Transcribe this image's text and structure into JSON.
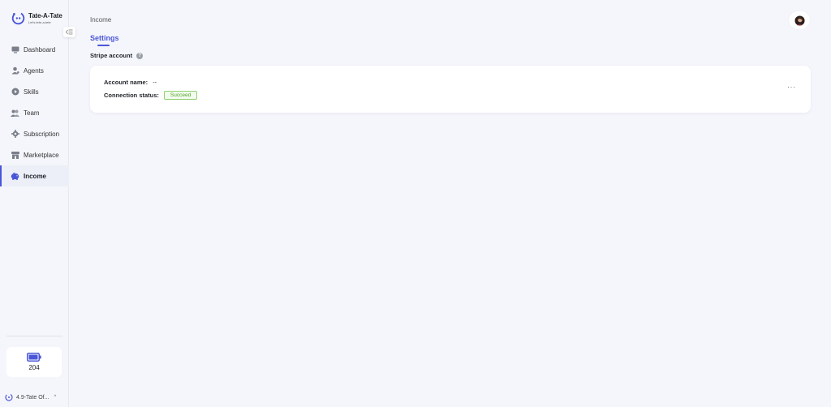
{
  "brand": {
    "name": "Tate-A-Tate",
    "tagline": "Let's tete-a-tete"
  },
  "sidebar": {
    "items": [
      {
        "label": "Dashboard",
        "icon": "dashboard-icon",
        "active": false
      },
      {
        "label": "Agents",
        "icon": "agents-icon",
        "active": false
      },
      {
        "label": "Skills",
        "icon": "skills-icon",
        "active": false
      },
      {
        "label": "Team",
        "icon": "team-icon",
        "active": false
      },
      {
        "label": "Subscription",
        "icon": "subscription-icon",
        "active": false
      },
      {
        "label": "Marketplace",
        "icon": "marketplace-icon",
        "active": false
      },
      {
        "label": "Income",
        "icon": "income-icon",
        "active": true
      }
    ],
    "credits": {
      "value": "204",
      "icon": "battery-icon"
    },
    "version": "4.9-Tate Of..."
  },
  "header": {
    "breadcrumb": "Income"
  },
  "tabs": [
    {
      "label": "Settings",
      "active": true
    }
  ],
  "stripe": {
    "section_title": "Stripe account",
    "account_name_label": "Account name:",
    "account_name_value": "--",
    "connection_status_label": "Connection status:",
    "connection_status_value": "Succeed",
    "more_label": "···"
  },
  "colors": {
    "accent": "#4a56d8",
    "success": "#4fa52a",
    "background": "#f5f6fc"
  }
}
